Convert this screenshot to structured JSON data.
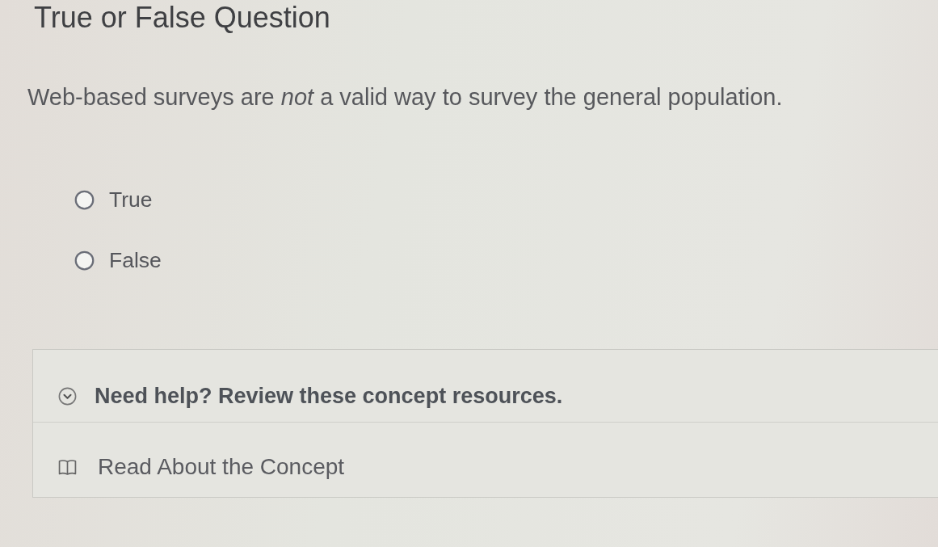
{
  "title": "True or False Question",
  "question": "Web-based surveys are *not* a valid way to survey the general population.",
  "options": [
    {
      "label": "True",
      "selected": false
    },
    {
      "label": "False",
      "selected": false
    }
  ],
  "help": {
    "heading": "Need help? Review these concept resources.",
    "expanded": true,
    "resources": [
      {
        "label": "Read About the Concept"
      }
    ]
  }
}
